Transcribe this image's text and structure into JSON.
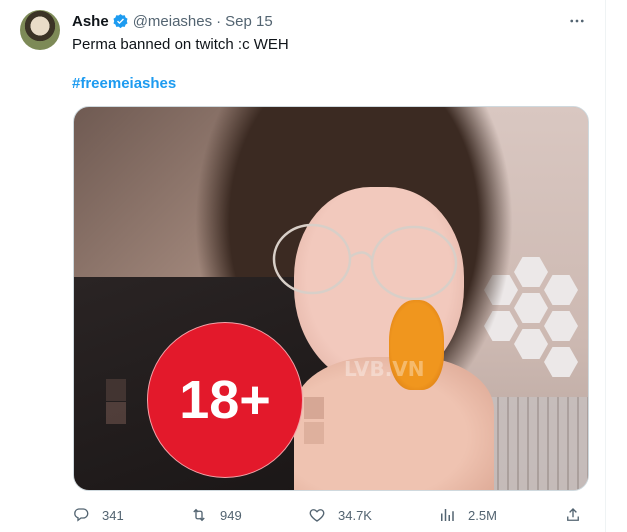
{
  "tweet": {
    "author": {
      "display_name": "Ashe",
      "handle": "@meiashes",
      "date": "Sep 15",
      "verified": true
    },
    "text": "Perma banned on twitch :c WEH",
    "hashtag": "#freemeiashes",
    "media": {
      "overlay_label": "18+",
      "watermark": "LVB.VN"
    },
    "actions": {
      "replies": "341",
      "retweets": "949",
      "likes": "34.7K",
      "views": "2.5M"
    }
  },
  "colors": {
    "accent": "#1d9bf0",
    "text": "#0f1419",
    "muted": "#536471",
    "badge": "#e3192b"
  },
  "icons": [
    "verified-badge-icon",
    "more-icon",
    "reply-icon",
    "retweet-icon",
    "like-icon",
    "views-icon",
    "share-icon"
  ]
}
